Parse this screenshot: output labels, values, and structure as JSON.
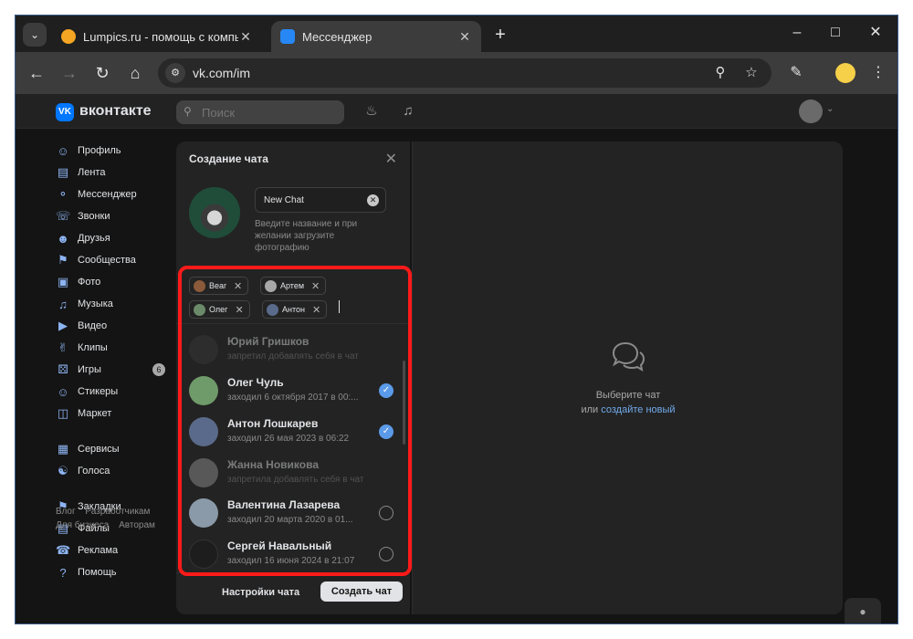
{
  "browser": {
    "tabs": [
      {
        "title": "Lumpics.ru - помощь с компь",
        "favicon_color": "#f5a623"
      },
      {
        "title": "Мессенджер",
        "favicon_color": "#2787f5"
      }
    ],
    "url": "vk.com/im"
  },
  "vk": {
    "brand": "вконтакте",
    "search_placeholder": "Поиск",
    "nav": [
      {
        "label": "Профиль",
        "icon": "profile-icon"
      },
      {
        "label": "Лента",
        "icon": "feed-icon"
      },
      {
        "label": "Мессенджер",
        "icon": "messenger-icon"
      },
      {
        "label": "Звонки",
        "icon": "calls-icon"
      },
      {
        "label": "Друзья",
        "icon": "friends-icon"
      },
      {
        "label": "Сообщества",
        "icon": "communities-icon"
      },
      {
        "label": "Фото",
        "icon": "photo-icon"
      },
      {
        "label": "Музыка",
        "icon": "music-icon"
      },
      {
        "label": "Видео",
        "icon": "video-icon"
      },
      {
        "label": "Клипы",
        "icon": "clips-icon"
      },
      {
        "label": "Игры",
        "icon": "games-icon",
        "badge": "6"
      },
      {
        "label": "Стикеры",
        "icon": "stickers-icon"
      },
      {
        "label": "Маркет",
        "icon": "market-icon"
      }
    ],
    "nav2": [
      {
        "label": "Сервисы",
        "icon": "services-icon"
      },
      {
        "label": "Голоса",
        "icon": "votes-icon"
      }
    ],
    "nav3": [
      {
        "label": "Закладки",
        "icon": "bookmarks-icon"
      },
      {
        "label": "Файлы",
        "icon": "files-icon"
      },
      {
        "label": "Реклама",
        "icon": "ads-icon"
      },
      {
        "label": "Помощь",
        "icon": "help-icon"
      }
    ],
    "footer": [
      "Блог",
      "Разработчикам",
      "Для бизнеса",
      "Авторам"
    ]
  },
  "create_chat": {
    "title": "Создание чата",
    "name_value": "New Chat",
    "hint": "Введите название и при желании загрузите фотографию",
    "tags": [
      "Bear",
      "Артем",
      "Олег",
      "Антон"
    ],
    "contacts": [
      {
        "name": "Юрий Гришков",
        "status": "запретил добавлять себя в чат",
        "disabled": true,
        "checked": false
      },
      {
        "name": "Олег Чуль",
        "status": "заходил 6 октября 2017 в 00:...",
        "disabled": false,
        "checked": true
      },
      {
        "name": "Антон Лошкарев",
        "status": "заходил 26 мая 2023 в 06:22",
        "disabled": false,
        "checked": true
      },
      {
        "name": "Жанна Новикова",
        "status": "запретила добавлять себя в чат",
        "disabled": true,
        "checked": false
      },
      {
        "name": "Валентина Лазарева",
        "status": "заходил 20 марта 2020 в 01...",
        "disabled": false,
        "checked": false
      },
      {
        "name": "Сергей Навальный",
        "status": "заходил 16 июня 2024 в 21:07",
        "disabled": false,
        "checked": false
      }
    ],
    "settings_label": "Настройки чата",
    "create_label": "Создать чат"
  },
  "empty_state": {
    "line1": "Выберите чат",
    "line2_prefix": "или",
    "line2_link": "создайте новый"
  },
  "colors": {
    "accent": "#5b9ae8",
    "link": "#71aaeb",
    "highlight": "#ff1a1a"
  }
}
